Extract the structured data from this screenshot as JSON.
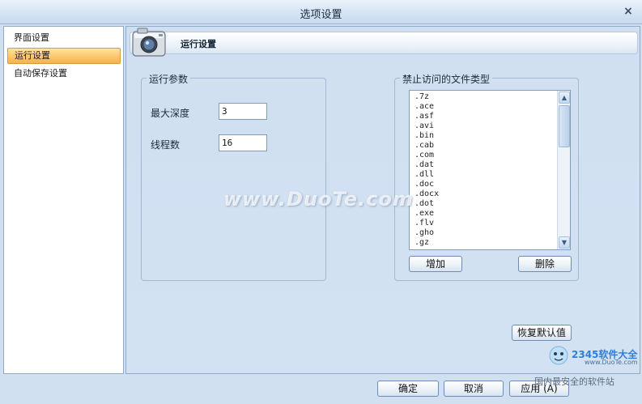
{
  "window": {
    "title": "选项设置",
    "close_glyph": "×"
  },
  "nav": {
    "items": [
      {
        "label": "界面设置",
        "active": false
      },
      {
        "label": "运行设置",
        "active": true
      },
      {
        "label": "自动保存设置",
        "active": false
      }
    ]
  },
  "header": {
    "title": "运行设置",
    "icon": "camera-icon"
  },
  "run_params": {
    "legend": "运行参数",
    "max_depth": {
      "label": "最大深度",
      "value": "3"
    },
    "threads": {
      "label": "线程数",
      "value": "16"
    }
  },
  "forbidden_types": {
    "legend": "禁止访问的文件类型",
    "items": [
      ".7z",
      ".ace",
      ".asf",
      ".avi",
      ".bin",
      ".cab",
      ".com",
      ".dat",
      ".dll",
      ".doc",
      ".docx",
      ".dot",
      ".exe",
      ".flv",
      ".gho",
      ".gz"
    ],
    "add_label": "增加",
    "delete_label": "删除"
  },
  "restore_default_label": "恢复默认值",
  "footer": {
    "ok_label": "确定",
    "cancel_label": "取消",
    "apply_label": "应用 (A)"
  },
  "watermark": "www.DuoTe.com",
  "corner_logo": {
    "brand": "2345软件大全",
    "url": "www.DuoTe.com",
    "tagline": "国内最安全的软件站"
  }
}
